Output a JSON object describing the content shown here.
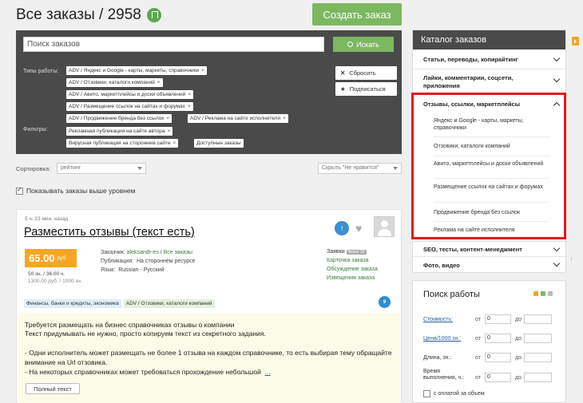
{
  "header": {
    "title": "Все заказы / 2958",
    "create_button": "Создать заказ"
  },
  "filters": {
    "search_placeholder": "Поиск заказов",
    "search_button": "Искать",
    "work_types_label": "Типы работы:",
    "filters_label": "Фильтры:",
    "tags": [
      "ADV / Яндекс и Google - карты, маркеты, справочники",
      "ADV / Отзовики, каталоги компаний",
      "ADV / Авито, маркетплейсы и доски объявлений",
      "ADV / Размещение ссылок на сайтах и форумах",
      "ADV / Продвижение бренда без ссылок",
      "ADV / Реклама на сайте исполнителя"
    ],
    "filter_tags": [
      "Рекламная публикация на сайте автора",
      "Вирусная публикация на стороннем сайте",
      "Доступные заказы"
    ],
    "tag_close": "×",
    "reset_button": "Сбросить",
    "subscribe_button": "Подписаться"
  },
  "sorting": {
    "label": "Сортировка:",
    "value": "рейтинг",
    "secondary_value": "Скрыть \"Не нравится\"",
    "show_above_level": "Показывать заказы выше уровнем"
  },
  "order": {
    "time": "5 ч. 23 мин. назад",
    "title": "Разместить отзывы (текст есть)",
    "price": "65.00",
    "price_unit": "руб.",
    "rate_line1": "50 зн. / 36.00 ч.",
    "rate_line2": "1300.00 руб. / 1000 зн.",
    "customer_label": "Заказчик:",
    "customer": "aleksandr-es",
    "all_orders": "Все заказы",
    "publication_label": "Публикация:",
    "publication": "На стороннем ресурсе",
    "language_label": "Язык:",
    "language": "Russian - Русский",
    "bids_label": "Заявки",
    "bids_badge": "более 10",
    "links": [
      "Карточка заказа",
      "Обсуждение заказа",
      "Извещения заказа"
    ],
    "categories": [
      "Финансы, банки и кредиты, экономика",
      "ADV / Отзовики, каталоги компаний"
    ],
    "gear_count": "9",
    "description": [
      "Требуется размещать на бизнес справочниках отзывы о компании",
      "Текст придумывать не нужно, просто копируем текст из секретного задания.",
      "",
      "- Одни исполнитель может размещать не более 1 отзыва на каждом справочнике, то есть выбирая тему обращайте",
      "внимание на Url отзовика.",
      "- На некоторых справочниках может требоваться прохождение небольшой"
    ],
    "more": "...",
    "full_text_button": "Полный текст"
  },
  "catalog": {
    "title": "Каталог заказов",
    "sections": [
      "Статьи, переводы, копирайтинг",
      "Лайки, комментарии, соцсети, приложения",
      "Отзывы, ссылки, маркетплейсы",
      "SEO, тесты, контент-менеджмент",
      "Фото, видео"
    ],
    "subitems": [
      "Яндекс и Google - карты, маркеты, справочники",
      "Отзовики, каталоги компаний",
      "Авито, маркетплейсы и доски объявлений",
      "Размещение ссылок на сайтах и форумах",
      "Продвижение бренда без ссылок",
      "Реклама на сайте исполнителя"
    ],
    "highlight_color": "#e3191c"
  },
  "work_search": {
    "title": "Поиск работы",
    "cost_label": "Стоимость:",
    "price_per_label": "Цена/1000 зн.:",
    "length_label": "Длина, зн.:",
    "time_label_1": "Время",
    "time_label_2": "выполнения, ч.:",
    "from": "от",
    "to": "до",
    "zero": "0",
    "fee_checkbox": "с оплатой за объем"
  },
  "colors": {
    "accent_green": "#7cb85f",
    "price_orange": "#f5a623",
    "dark_panel": "#4a4a4a"
  }
}
